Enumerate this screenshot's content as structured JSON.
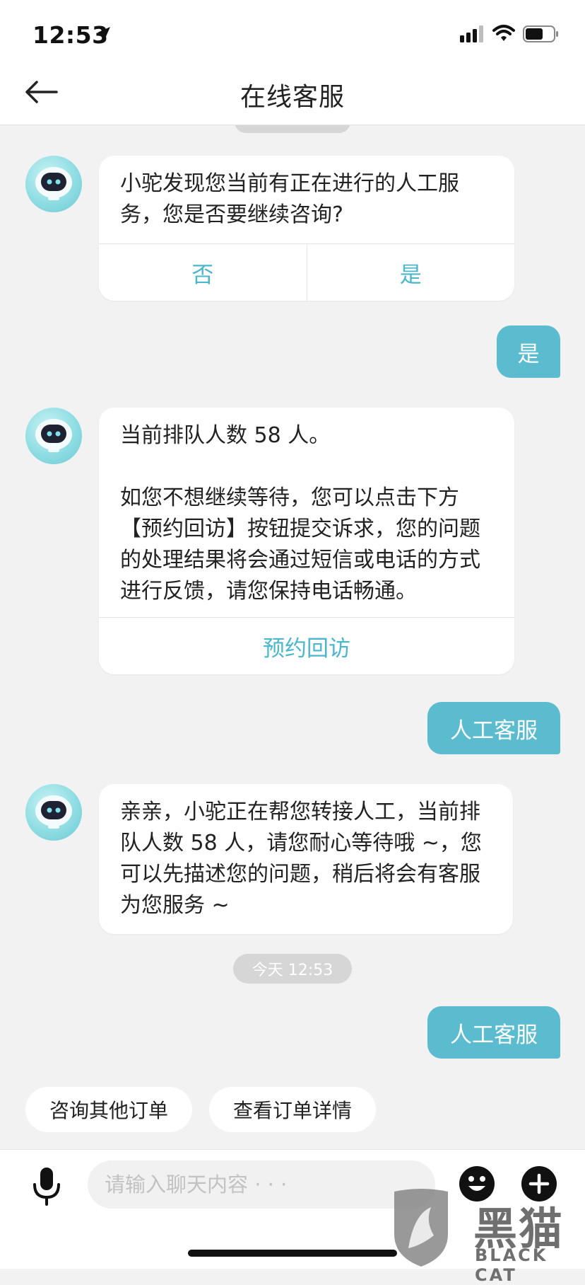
{
  "status_bar": {
    "time": "12:53"
  },
  "header": {
    "title": "在线客服",
    "back_icon": "arrow-left-icon"
  },
  "messages": [
    {
      "sender": "bot",
      "text": [
        "小驼发现您当前有正在进行的人工服务，您是否要继续咨询?"
      ],
      "actions": [
        "否",
        "是"
      ]
    },
    {
      "sender": "user",
      "text": "是"
    },
    {
      "sender": "bot",
      "text": [
        "当前排队人数 58 人。",
        "",
        "如您不想继续等待，您可以点击下方【预约回访】按钮提交诉求，您的问题的处理结果将会通过短信或电话的方式进行反馈，请您保持电话畅通。"
      ],
      "actions": [
        "预约回访"
      ]
    },
    {
      "sender": "user",
      "text": "人工客服"
    },
    {
      "sender": "bot",
      "text": [
        "亲亲，小驼正在帮您转接人工，当前排队人数 58 人，请您耐心等待哦 ~，您可以先描述您的问题，稍后将会有客服为您服务 ~"
      ]
    },
    {
      "sender": "timestamp",
      "text": "今天 12:53"
    },
    {
      "sender": "user",
      "text": "人工客服"
    }
  ],
  "quick_replies": [
    "咨询其他订单",
    "查看订单详情"
  ],
  "input_bar": {
    "placeholder": "请输入聊天内容 · · ·",
    "value": "",
    "icons": [
      "microphone-icon",
      "emoji-icon",
      "plus-icon"
    ]
  },
  "watermark": {
    "cn": "黑猫",
    "en": "BLACK CAT"
  },
  "colors": {
    "accent": "#5bbcd0",
    "link": "#4ab7cd",
    "background": "#f2f2f2"
  }
}
